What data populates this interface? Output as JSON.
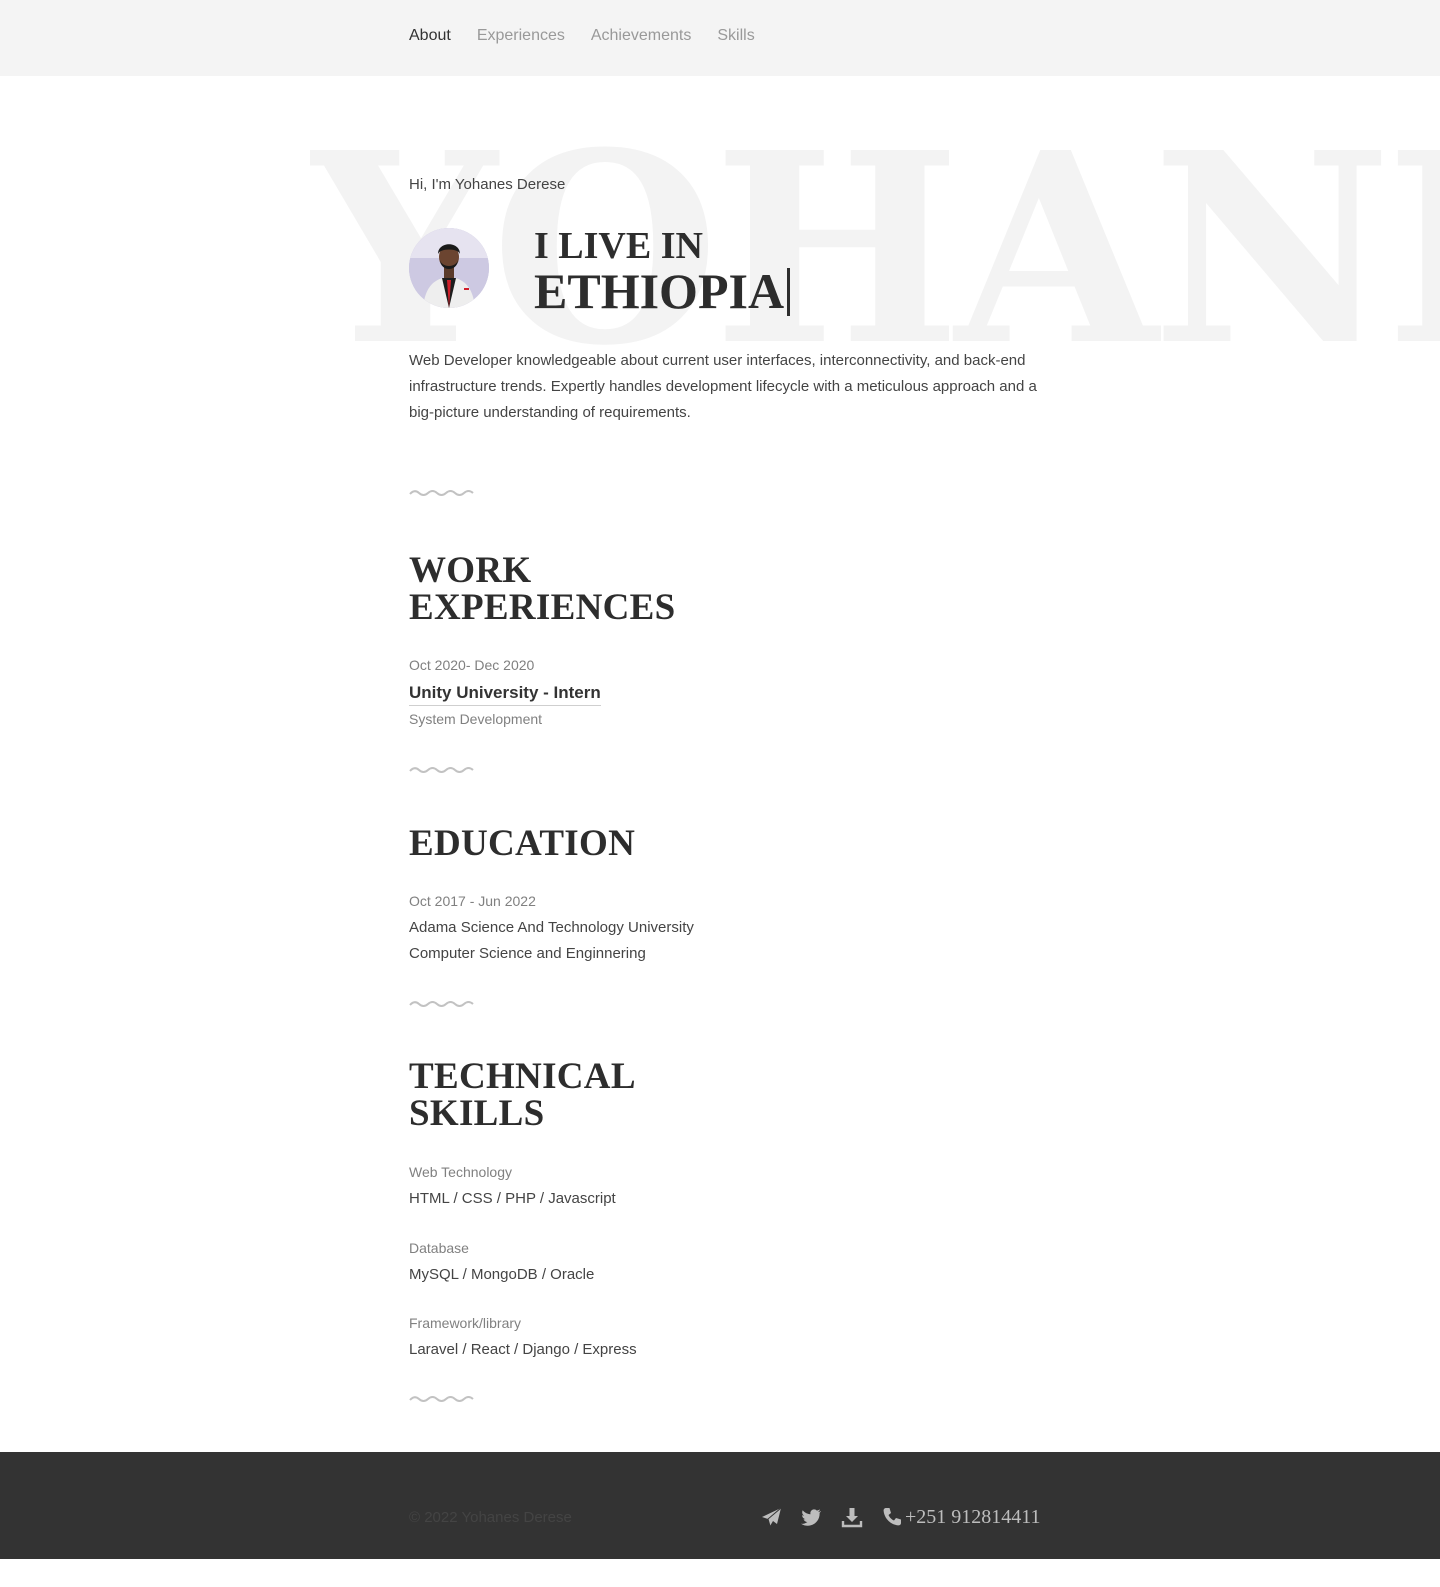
{
  "nav": {
    "items": [
      {
        "label": "About"
      },
      {
        "label": "Experiences"
      },
      {
        "label": "Achievements"
      },
      {
        "label": "Skills"
      }
    ]
  },
  "hero": {
    "background_name": "YOHANE",
    "greeting": "Hi, I'm Yohanes Derese",
    "live_prefix": "I LIVE IN",
    "live_place": "ETHIOPIA",
    "bio": "Web Developer knowledgeable about current user interfaces, interconnectivity, and back-end infrastructure trends. Expertly handles development lifecycle with a meticulous approach and a big-picture understanding of requirements."
  },
  "work": {
    "title_line1": "WORK",
    "title_line2": "EXPERIENCES",
    "period": "Oct 2020- Dec 2020",
    "role": "Unity University - Intern",
    "area": "System Development"
  },
  "education": {
    "title": "EDUCATION",
    "period": "Oct 2017 - Jun 2022",
    "school": "Adama Science And Technology University",
    "program": "Computer Science and Enginnering"
  },
  "skills": {
    "title_line1": "TECHNICAL",
    "title_line2": "SKILLS",
    "groups": [
      {
        "label": "Web Technology",
        "value": "HTML / CSS / PHP / Javascript"
      },
      {
        "label": "Database",
        "value": "MySQL / MongoDB / Oracle"
      },
      {
        "label": "Framework/library",
        "value": "Laravel / React / Django / Express"
      }
    ]
  },
  "footer": {
    "copyright": "© 2022 Yohanes Derese",
    "phone": "+251 912814411"
  }
}
